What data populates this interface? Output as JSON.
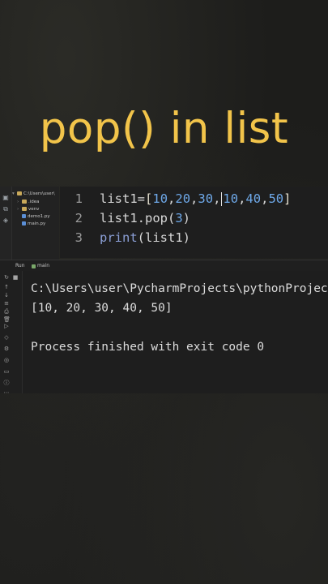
{
  "title": "pop() in list",
  "project_tree": {
    "root": "C:\\Users\\user\\",
    "items": [
      ".idea",
      "venv",
      "demo1.py",
      "main.py"
    ]
  },
  "editor": {
    "lines": [
      {
        "number": "1",
        "parts": [
          {
            "t": "list1",
            "c": "plain"
          },
          {
            "t": "=",
            "c": "plain"
          },
          {
            "t": "[",
            "c": "br"
          },
          {
            "t": "10",
            "c": "num"
          },
          {
            "t": ",",
            "c": "plain"
          },
          {
            "t": "20",
            "c": "num"
          },
          {
            "t": ",",
            "c": "plain"
          },
          {
            "t": "30",
            "c": "num"
          },
          {
            "t": ",",
            "c": "plain"
          },
          {
            "t": "|",
            "c": "caret"
          },
          {
            "t": "10",
            "c": "num"
          },
          {
            "t": ",",
            "c": "plain"
          },
          {
            "t": "40",
            "c": "num"
          },
          {
            "t": ",",
            "c": "plain"
          },
          {
            "t": "50",
            "c": "num"
          },
          {
            "t": "]",
            "c": "br"
          }
        ]
      },
      {
        "number": "2",
        "parts": [
          {
            "t": "list1.pop(",
            "c": "plain"
          },
          {
            "t": "3",
            "c": "num"
          },
          {
            "t": ")",
            "c": "plain"
          }
        ]
      },
      {
        "number": "3",
        "parts": [
          {
            "t": "print",
            "c": "kw"
          },
          {
            "t": "(list1)",
            "c": "plain"
          }
        ]
      }
    ]
  },
  "run": {
    "label": "Run",
    "tab": "main"
  },
  "console": {
    "lines": [
      "C:\\Users\\user\\PycharmProjects\\pythonProjec",
      "[10, 20, 30, 40, 50]",
      "",
      "Process finished with exit code 0"
    ]
  },
  "icons": {
    "rail": [
      "project-icon",
      "structure-icon",
      "bookmarks-icon"
    ],
    "run_toolbar": [
      "rerun-icon",
      "stop-icon",
      "scroll-icon",
      "up-icon",
      "down-icon",
      "run-icon",
      "layers-icon",
      "debug-icon",
      "services-icon",
      "terminal-icon",
      "problems-icon",
      "more-icon"
    ]
  },
  "colors": {
    "title": "#f2c44a",
    "number": "#6ea8e8",
    "keyword": "#8b9fd6",
    "background": "#1d1d1b"
  }
}
